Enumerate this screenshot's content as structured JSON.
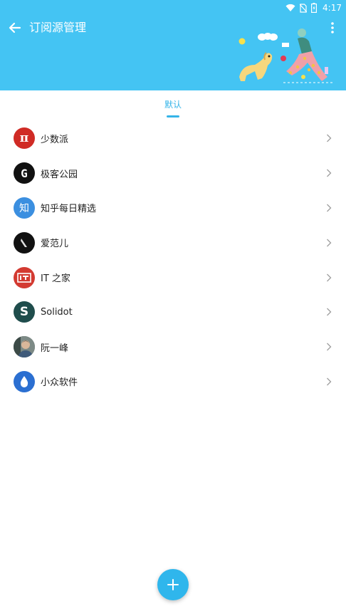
{
  "status_bar": {
    "time": "4:17"
  },
  "toolbar": {
    "title": "订阅源管理"
  },
  "tabs": [
    {
      "label": "默认",
      "active": true
    }
  ],
  "subscriptions": [
    {
      "label": "少数派",
      "icon": "sspai-pi-icon",
      "color": "#d02b25"
    },
    {
      "label": "极客公园",
      "icon": "geekpark-g-icon",
      "color": "#111111"
    },
    {
      "label": "知乎每日精选",
      "icon": "zhihu-zhi-icon",
      "color": "#3b8fe0"
    },
    {
      "label": "爱范儿",
      "icon": "ifanr-icon",
      "color": "#111111"
    },
    {
      "label": "IT 之家",
      "icon": "ithome-icon",
      "color": "#d33a31"
    },
    {
      "label": "Solidot",
      "icon": "solidot-s-icon",
      "color": "#1f4d4c"
    },
    {
      "label": "阮一峰",
      "icon": "ruanyifeng-photo-avatar",
      "color": "#5a6b66"
    },
    {
      "label": "小众软件",
      "icon": "appinn-drop-icon",
      "color": "#2b6fd1"
    }
  ],
  "avatar_glyphs": {
    "sspai": "π",
    "geekpark": "G",
    "zhihu": "知",
    "solidot": "S"
  },
  "colors": {
    "header": "#44c4f3",
    "accent": "#35b4e8",
    "fab": "#2fb6ec"
  }
}
